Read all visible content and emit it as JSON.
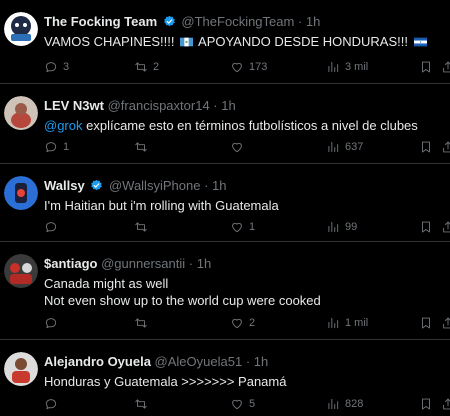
{
  "colors": {
    "background": "#000000",
    "text": "#e7e9ea",
    "muted": "#71767b",
    "link": "#1d9bf0",
    "verified": "#1d9bf0",
    "divider": "#2f3336"
  },
  "tweets": [
    {
      "name": "The Focking Team",
      "handle": "@TheFockingTeam",
      "time": "1h",
      "verified": true,
      "text_parts": [
        "VAMOS CHAPINES!!!! ",
        " APOYANDO DESDE HONDURAS!!! "
      ],
      "flags": [
        "guatemala-flag",
        "honduras-flag"
      ],
      "replies": "3",
      "retweets": "2",
      "likes": "173",
      "views": "3 mil"
    },
    {
      "name": "LEV N3wt",
      "handle": "@francispaxtor14",
      "time": "1h",
      "verified": false,
      "mention": "@grok",
      "text": " explícame esto en términos futbolísticos a nivel de clubes",
      "replies": "1",
      "retweets": "",
      "likes": "",
      "views": "637"
    },
    {
      "name": "Wallsy",
      "handle": "@WallsyiPhone",
      "time": "1h",
      "verified": true,
      "text": "I'm Haitian but i'm rolling with Guatemala",
      "replies": "",
      "retweets": "",
      "likes": "1",
      "views": "99"
    },
    {
      "name": "$antiago",
      "handle": "@gunnersantii",
      "time": "1h",
      "verified": false,
      "text_line1": "Canada might as well",
      "text_line2": "Not even show up to the world cup were cooked",
      "replies": "",
      "retweets": "",
      "likes": "2",
      "views": "1 mil"
    },
    {
      "name": "Alejandro Oyuela",
      "handle": "@AleOyuela51",
      "time": "1h",
      "verified": false,
      "text": "Honduras y Guatemala >>>>>>> Panamá",
      "replies": "",
      "retweets": "",
      "likes": "5",
      "views": "828"
    }
  ],
  "separator": "·"
}
